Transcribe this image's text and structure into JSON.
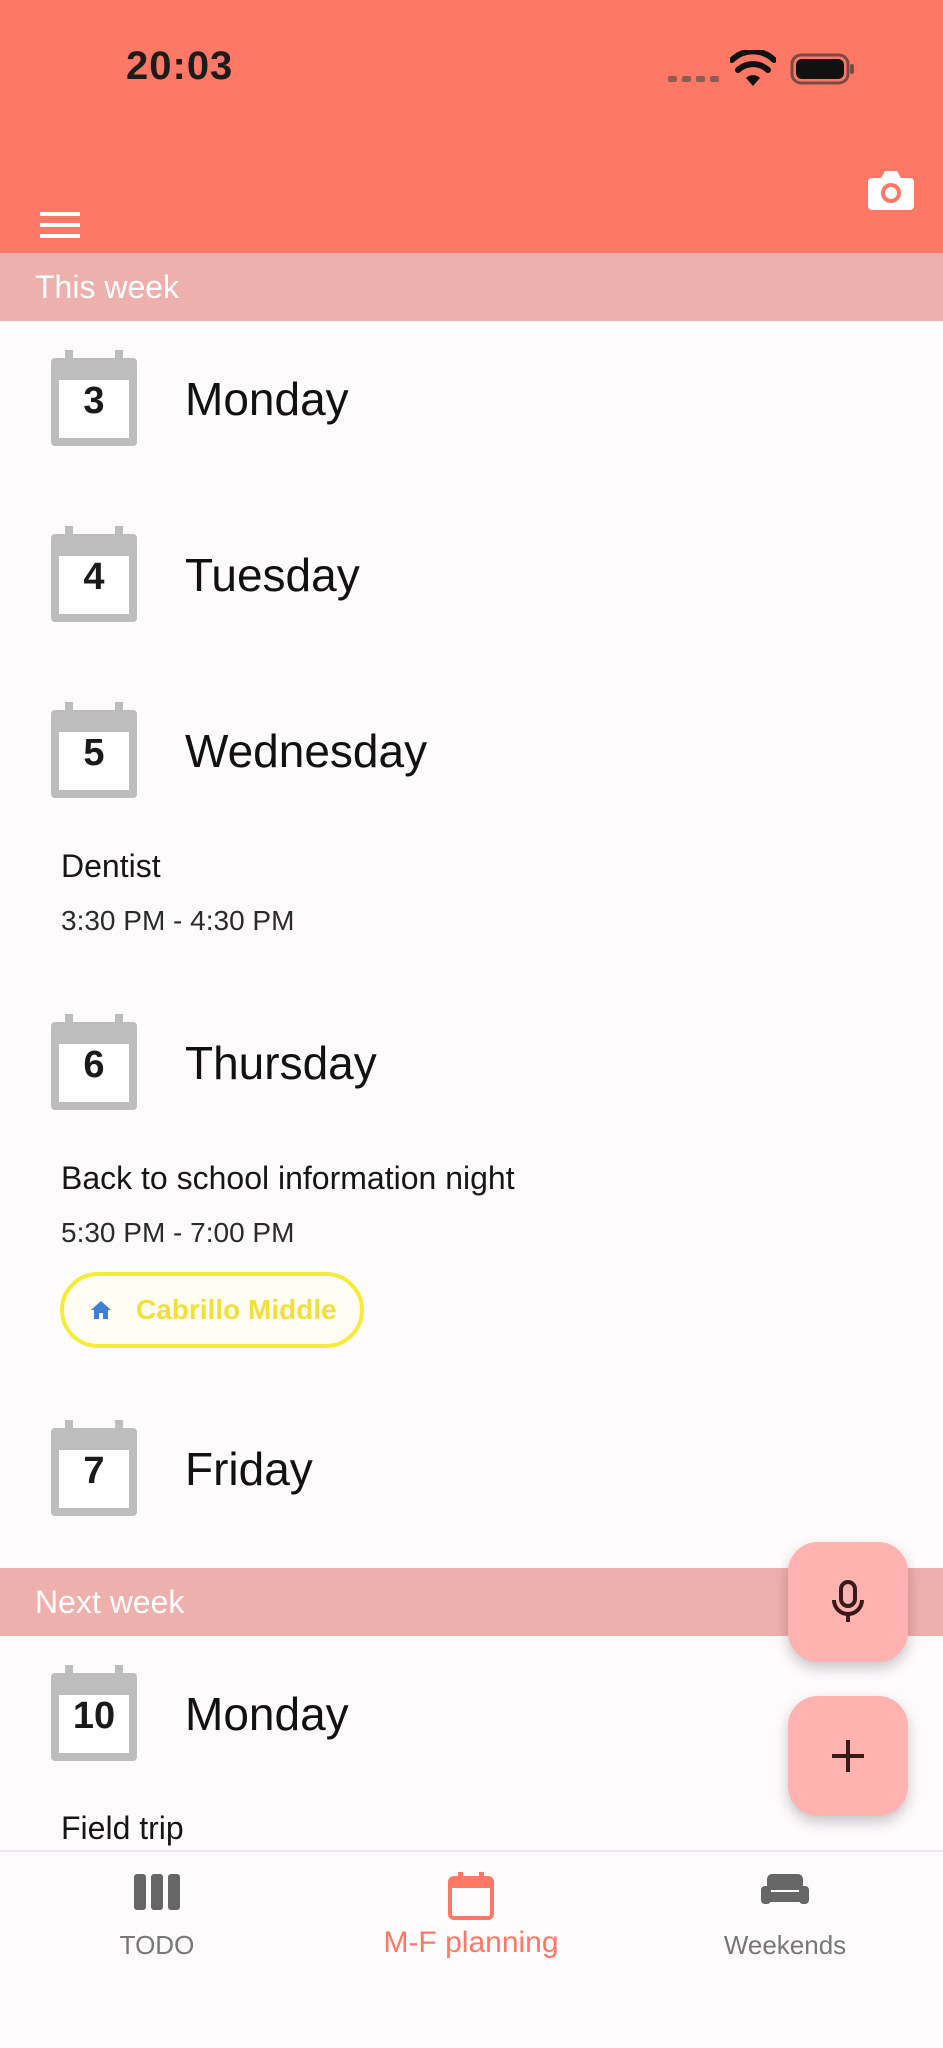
{
  "status_bar": {
    "time": "20:03"
  },
  "sections": [
    {
      "title": "This week"
    },
    {
      "title": "Next week"
    }
  ],
  "days": [
    {
      "num": "3",
      "name": "Monday"
    },
    {
      "num": "4",
      "name": "Tuesday"
    },
    {
      "num": "5",
      "name": "Wednesday"
    },
    {
      "num": "6",
      "name": "Thursday"
    },
    {
      "num": "7",
      "name": "Friday"
    },
    {
      "num": "10",
      "name": "Monday"
    }
  ],
  "events": [
    {
      "title": "Dentist",
      "time": "3:30 PM - 4:30 PM"
    },
    {
      "title": "Back to school information night",
      "time": "5:30 PM - 7:00 PM",
      "location": "Cabrillo Middle"
    },
    {
      "title": "Field trip"
    }
  ],
  "bottom_nav": [
    {
      "label": "TODO",
      "icon": "columns-icon",
      "active": false
    },
    {
      "label": "M-F planning",
      "icon": "calendar-icon",
      "active": true
    },
    {
      "label": "Weekends",
      "icon": "sofa-icon",
      "active": false
    }
  ],
  "colors": {
    "app_bar": "#ff7866",
    "section_header": "#eeb0ac",
    "fab": "#ffb2b0",
    "active_nav": "#ff7866",
    "location_chip": "#f5ec3a"
  }
}
